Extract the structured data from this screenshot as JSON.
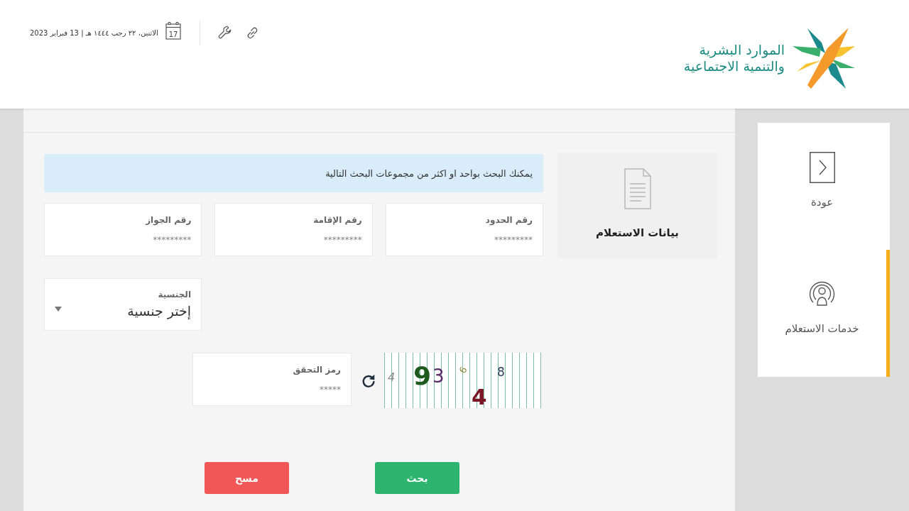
{
  "header": {
    "logo": {
      "lines": [
        "الموارد البشرية",
        "والتنمية الاجتماعية"
      ]
    },
    "date": {
      "day": "17",
      "text": "الاثنين، ٢٢ رجب ١٤٤٤ هـ | 13 فبراير 2023"
    }
  },
  "sidebar": {
    "items": [
      {
        "kind": "back",
        "label": "عودة",
        "selected": false
      },
      {
        "kind": "services",
        "label": "خدمات الاستعلام",
        "selected": true
      }
    ]
  },
  "section": {
    "title": "بيانات الاستعلام"
  },
  "search_form": {
    "notice": "يمكنك البحث بواحد او اكثر من مجموعات البحث التالية",
    "fields": [
      {
        "label": "رقم الحدود",
        "placeholder": "*********"
      },
      {
        "label": "رقم الإقامة",
        "placeholder": "*********"
      },
      {
        "label": "رقم الجواز",
        "placeholder": "*********"
      }
    ],
    "nationality": {
      "label": "الجنسية",
      "value": "إختر جنسية"
    },
    "captcha": {
      "label": "رمز التحقق",
      "placeholder": "*****",
      "characters": [
        {
          "text": "8",
          "color": "#2d3e5c"
        },
        {
          "text": "4",
          "color": "#7a1526"
        },
        {
          "text": "6",
          "color": "#8c8a3c"
        },
        {
          "text": "3",
          "color": "#5b2a6b"
        },
        {
          "text": "9",
          "color": "#1e5a1e"
        },
        {
          "text": "4",
          "color": "#8a8a8a"
        }
      ]
    },
    "buttons": [
      {
        "kind": "primary",
        "label": "بحث"
      },
      {
        "kind": "danger",
        "label": "مسح"
      }
    ]
  }
}
